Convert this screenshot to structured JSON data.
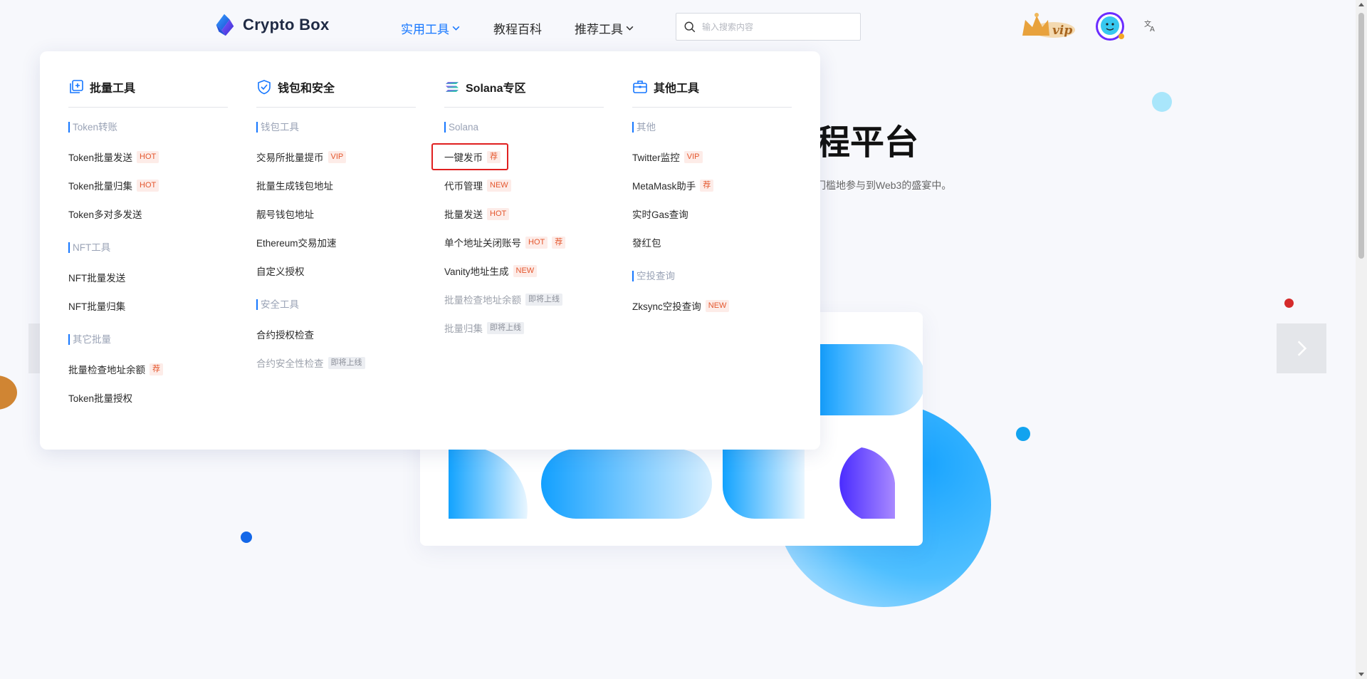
{
  "brand": {
    "name": "Crypto Box"
  },
  "nav": [
    {
      "label": "实用工具",
      "has_caret": true,
      "active": true
    },
    {
      "label": "教程百科",
      "has_caret": false,
      "active": false
    },
    {
      "label": "推荐工具",
      "has_caret": true,
      "active": false
    }
  ],
  "search": {
    "placeholder": "输入搜索内容",
    "value": ""
  },
  "header_icons": [
    "vip-crown-icon",
    "avatar-icon",
    "translate-icon"
  ],
  "hero": {
    "title_visible": "程平台",
    "subtitle_visible": "门槛地参与到Web3的盛宴中。"
  },
  "colors": {
    "accent": "#1677ff",
    "tag_text": "#e4572e",
    "tag_bg": "#fdece8",
    "highlight_border": "#e02020"
  },
  "menu": {
    "columns": [
      {
        "title": "批量工具",
        "icon": "batch-tools-icon",
        "groups": [
          {
            "label": "Token转账",
            "items": [
              {
                "label": "Token批量发送",
                "tag": "HOT",
                "tag_type": "hot",
                "disabled": false
              },
              {
                "label": "Token批量归集",
                "tag": "HOT",
                "tag_type": "hot",
                "disabled": false
              },
              {
                "label": "Token多对多发送",
                "tag": "",
                "tag_type": "",
                "disabled": false
              }
            ]
          },
          {
            "label": "NFT工具",
            "items": [
              {
                "label": "NFT批量发送",
                "tag": "",
                "tag_type": "",
                "disabled": false
              },
              {
                "label": "NFT批量归集",
                "tag": "",
                "tag_type": "",
                "disabled": false
              }
            ]
          },
          {
            "label": "其它批量",
            "items": [
              {
                "label": "批量检查地址余额",
                "tag": "荐",
                "tag_type": "rec",
                "disabled": false
              },
              {
                "label": "Token批量授权",
                "tag": "",
                "tag_type": "",
                "disabled": false
              }
            ]
          }
        ]
      },
      {
        "title": "钱包和安全",
        "icon": "shield-check-icon",
        "groups": [
          {
            "label": "钱包工具",
            "items": [
              {
                "label": "交易所批量提币",
                "tag": "VIP",
                "tag_type": "vip",
                "disabled": false
              },
              {
                "label": "批量生成钱包地址",
                "tag": "",
                "tag_type": "",
                "disabled": false
              },
              {
                "label": "靓号钱包地址",
                "tag": "",
                "tag_type": "",
                "disabled": false
              },
              {
                "label": "Ethereum交易加速",
                "tag": "",
                "tag_type": "",
                "disabled": false
              },
              {
                "label": "自定义授权",
                "tag": "",
                "tag_type": "",
                "disabled": false
              }
            ]
          },
          {
            "label": "安全工具",
            "items": [
              {
                "label": "合约授权检查",
                "tag": "",
                "tag_type": "",
                "disabled": false
              },
              {
                "label": "合约安全性检查",
                "tag": "即将上线",
                "tag_type": "soon",
                "disabled": true
              }
            ]
          }
        ]
      },
      {
        "title": "Solana专区",
        "icon": "solana-icon",
        "groups": [
          {
            "label": "Solana",
            "items": [
              {
                "label": "一键发币",
                "tag": "荐",
                "tag_type": "rec",
                "disabled": false,
                "highlighted": true
              },
              {
                "label": "代币管理",
                "tag": "NEW",
                "tag_type": "new",
                "disabled": false
              },
              {
                "label": "批量发送",
                "tag": "HOT",
                "tag_type": "hot",
                "disabled": false
              },
              {
                "label": "单个地址关闭账号",
                "tag": "HOT",
                "tag2": "荐",
                "tag_type": "hot",
                "disabled": false
              },
              {
                "label": "Vanity地址生成",
                "tag": "NEW",
                "tag_type": "new",
                "disabled": false
              },
              {
                "label": "批量检查地址余额",
                "tag": "即将上线",
                "tag_type": "soon",
                "disabled": true
              },
              {
                "label": "批量归集",
                "tag": "即将上线",
                "tag_type": "soon",
                "disabled": true
              }
            ]
          }
        ]
      },
      {
        "title": "其他工具",
        "icon": "toolbox-icon",
        "groups": [
          {
            "label": "其他",
            "items": [
              {
                "label": "Twitter监控",
                "tag": "VIP",
                "tag_type": "vip",
                "disabled": false
              },
              {
                "label": "MetaMask助手",
                "tag": "荐",
                "tag_type": "rec",
                "disabled": false
              },
              {
                "label": "实时Gas查询",
                "tag": "",
                "tag_type": "",
                "disabled": false
              },
              {
                "label": "發红包",
                "tag": "",
                "tag_type": "",
                "disabled": false
              }
            ]
          },
          {
            "label": "空投查询",
            "items": [
              {
                "label": "Zksync空投查询",
                "tag": "NEW",
                "tag_type": "new",
                "disabled": false
              }
            ]
          }
        ]
      }
    ]
  }
}
